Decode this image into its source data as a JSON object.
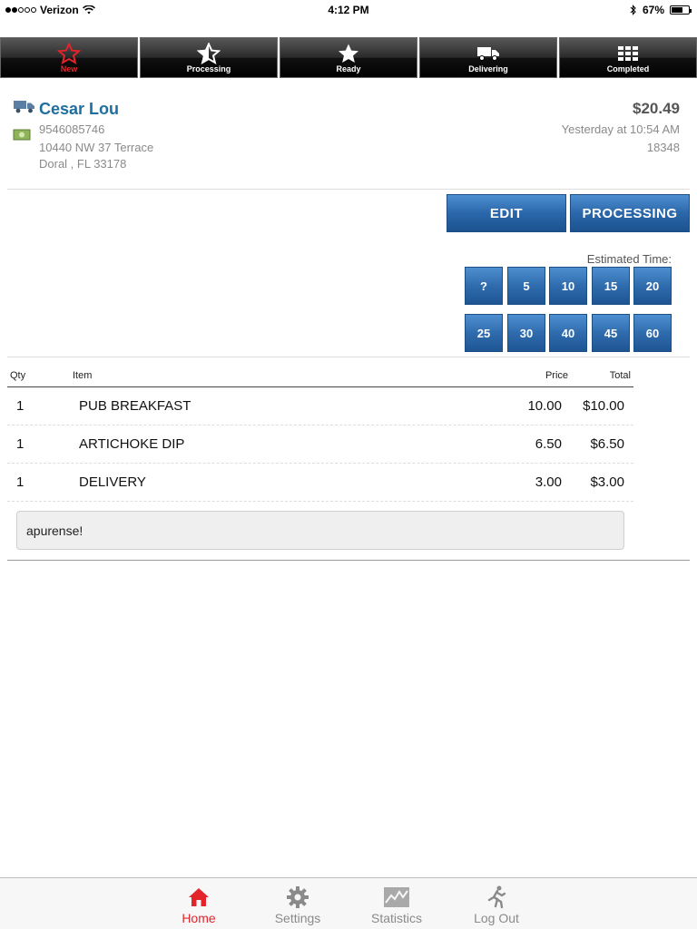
{
  "status_bar": {
    "carrier": "Verizon",
    "time": "4:12 PM",
    "battery": "67%",
    "battery_level": 0.67
  },
  "top_tabs": [
    {
      "label": "New",
      "icon": "star-outline-icon",
      "active": true
    },
    {
      "label": "Processing",
      "icon": "half-star-icon",
      "active": false
    },
    {
      "label": "Ready",
      "icon": "star-icon",
      "active": false
    },
    {
      "label": "Delivering",
      "icon": "truck-icon",
      "active": false
    },
    {
      "label": "Completed",
      "icon": "grid-icon",
      "active": false
    }
  ],
  "order": {
    "customer_name": "Cesar Lou",
    "phone": "9546085746",
    "address_line1": "10440 NW 37 Terrace",
    "address_line2": "Doral , FL 33178",
    "amount": "$20.49",
    "placed": "Yesterday at 10:54 AM",
    "order_number": "18348"
  },
  "actions": {
    "edit_label": "EDIT",
    "processing_label": "PROCESSING"
  },
  "estimated": {
    "label": "Estimated Time:",
    "options": [
      "?",
      "5",
      "10",
      "15",
      "20",
      "25",
      "30",
      "40",
      "45",
      "60"
    ]
  },
  "items_table": {
    "headers": {
      "qty": "Qty",
      "item": "Item",
      "price": "Price",
      "total": "Total"
    },
    "rows": [
      {
        "qty": "1",
        "item": "PUB BREAKFAST",
        "price": "10.00",
        "total": "$10.00"
      },
      {
        "qty": "1",
        "item": "ARTICHOKE DIP",
        "price": "6.50",
        "total": "$6.50"
      },
      {
        "qty": "1",
        "item": "DELIVERY",
        "price": "3.00",
        "total": "$3.00"
      }
    ]
  },
  "note": "apurense!",
  "bottom_tabs": [
    {
      "label": "Home",
      "icon": "home-icon",
      "active": true
    },
    {
      "label": "Settings",
      "icon": "gear-icon",
      "active": false
    },
    {
      "label": "Statistics",
      "icon": "chart-icon",
      "active": false
    },
    {
      "label": "Log Out",
      "icon": "running-man-icon",
      "active": false
    }
  ],
  "colors": {
    "accent_red": "#e3242b",
    "name_blue": "#1e6ea0",
    "button_blue": "#2a67aa"
  }
}
